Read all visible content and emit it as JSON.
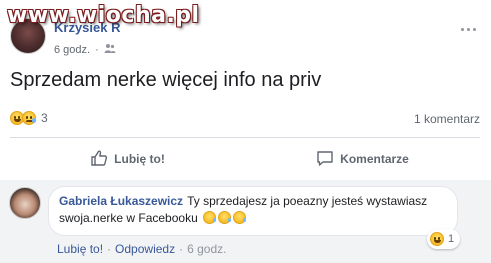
{
  "watermark": {
    "text": "www.wiocha.pl"
  },
  "post": {
    "author": "Krzysiek R",
    "time": "6 godz.",
    "privacy_icon": "friends-icon",
    "text": "Sprzedam nerke więcej info na priv",
    "reactions": {
      "icons": [
        "laughing-emoji-icon",
        "crying-emoji-icon"
      ],
      "count": "3"
    },
    "comments_count": "1 komentarz"
  },
  "actions": {
    "like_label": "Lubię to!",
    "comment_label": "Komentarze"
  },
  "comment": {
    "author": "Gabriela Łukaszewicz",
    "text": "Ty sprzedajesz ja poeazny jesteś wystawiasz swoja.nerke w Facebooku",
    "emojis": [
      "crying-emoji-icon",
      "crying-emoji-icon",
      "crying-emoji-icon"
    ],
    "like_label": "Lubię to!",
    "reply_label": "Odpowiedz",
    "separator": "·",
    "time": "6 godz.",
    "reaction_icon": "laughing-emoji-icon",
    "reaction_count": "1"
  },
  "colors": {
    "link_blue": "#385898",
    "secondary_text": "#606770",
    "comment_bg": "#f2f3f5"
  }
}
